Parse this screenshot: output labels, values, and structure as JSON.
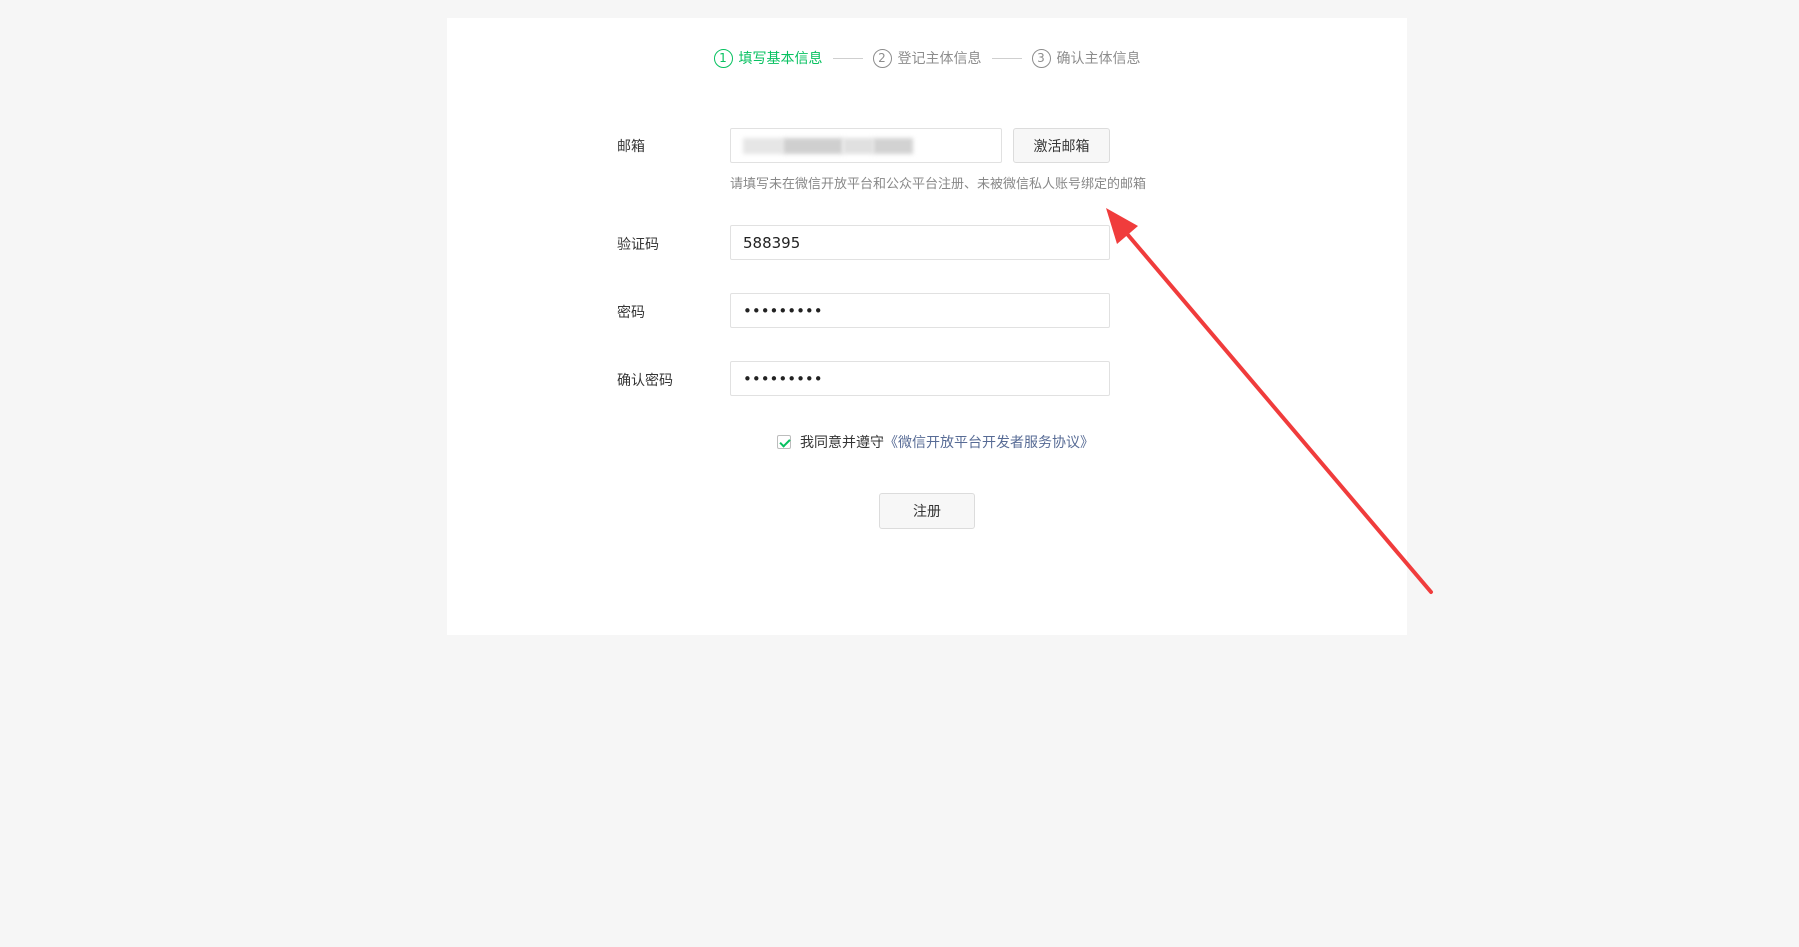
{
  "steps": [
    {
      "num": "1",
      "label": "填写基本信息"
    },
    {
      "num": "2",
      "label": "登记主体信息"
    },
    {
      "num": "3",
      "label": "确认主体信息"
    }
  ],
  "form": {
    "email_label": "邮箱",
    "activate_email_label": "激活邮箱",
    "email_hint": "请填写未在微信开放平台和公众平台注册、未被微信私人账号绑定的邮箱",
    "code_label": "验证码",
    "code_value": "588395",
    "password_label": "密码",
    "password_value": "•••••••••",
    "confirm_label": "确认密码",
    "confirm_value": "•••••••••",
    "agree_text": "我同意并遵守",
    "agree_link": "《微信开放平台开发者服务协议》",
    "register_label": "注册"
  },
  "colors": {
    "accent": "#07c160",
    "link": "#576b95",
    "arrow": "#f03c3c"
  }
}
